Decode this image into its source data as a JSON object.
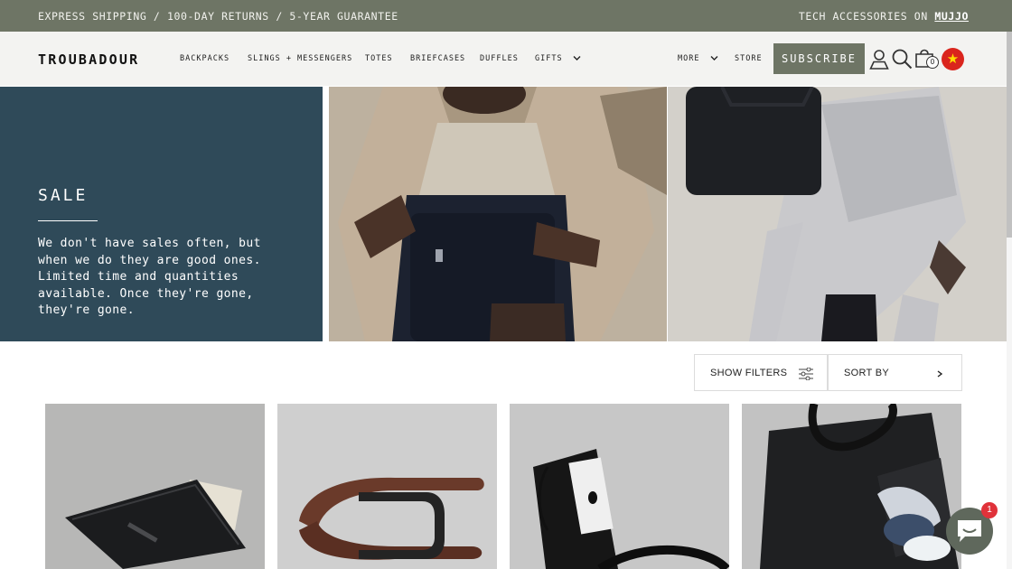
{
  "announcement": {
    "left_text": "EXPRESS SHIPPING / 100-DAY RETURNS / 5-YEAR GUARANTEE",
    "right_prefix": "TECH ACCESSORIES ON",
    "right_link": "MUJJO"
  },
  "header": {
    "logo": "TROUBADOUR",
    "nav": [
      {
        "label": "BACKPACKS"
      },
      {
        "label": "SLINGS + MESSENGERS"
      },
      {
        "label": "TOTES"
      },
      {
        "label": "BRIEFCASES"
      },
      {
        "label": "DUFFLES"
      },
      {
        "label": "GIFTS",
        "has_dropdown": true
      }
    ],
    "more_label": "MORE",
    "store_label": "STORE",
    "subscribe_label": "SUBSCRIBE",
    "cart_count": "0",
    "icons": [
      "account-icon",
      "search-icon",
      "cart-icon",
      "vietnam-flag-icon"
    ]
  },
  "promo": {
    "title": "SALE",
    "description": "We don't have sales often, but when we do they are good ones. Limited time and quantities available. Once they're gone, they're gone."
  },
  "toolbar": {
    "filters_label": "SHOW FILTERS",
    "sort_label": "SORT BY"
  },
  "products": [
    {
      "image": "black leather wallet"
    },
    {
      "image": "brown leather belt"
    },
    {
      "image": "black pouch and strap"
    },
    {
      "image": "black duffle bag with shoe compartment"
    }
  ],
  "chat": {
    "unread_count": "1"
  },
  "colors": {
    "brand_green": "#6e7565",
    "promo_blue": "#2f4a59",
    "badge_red": "#e0323a"
  }
}
